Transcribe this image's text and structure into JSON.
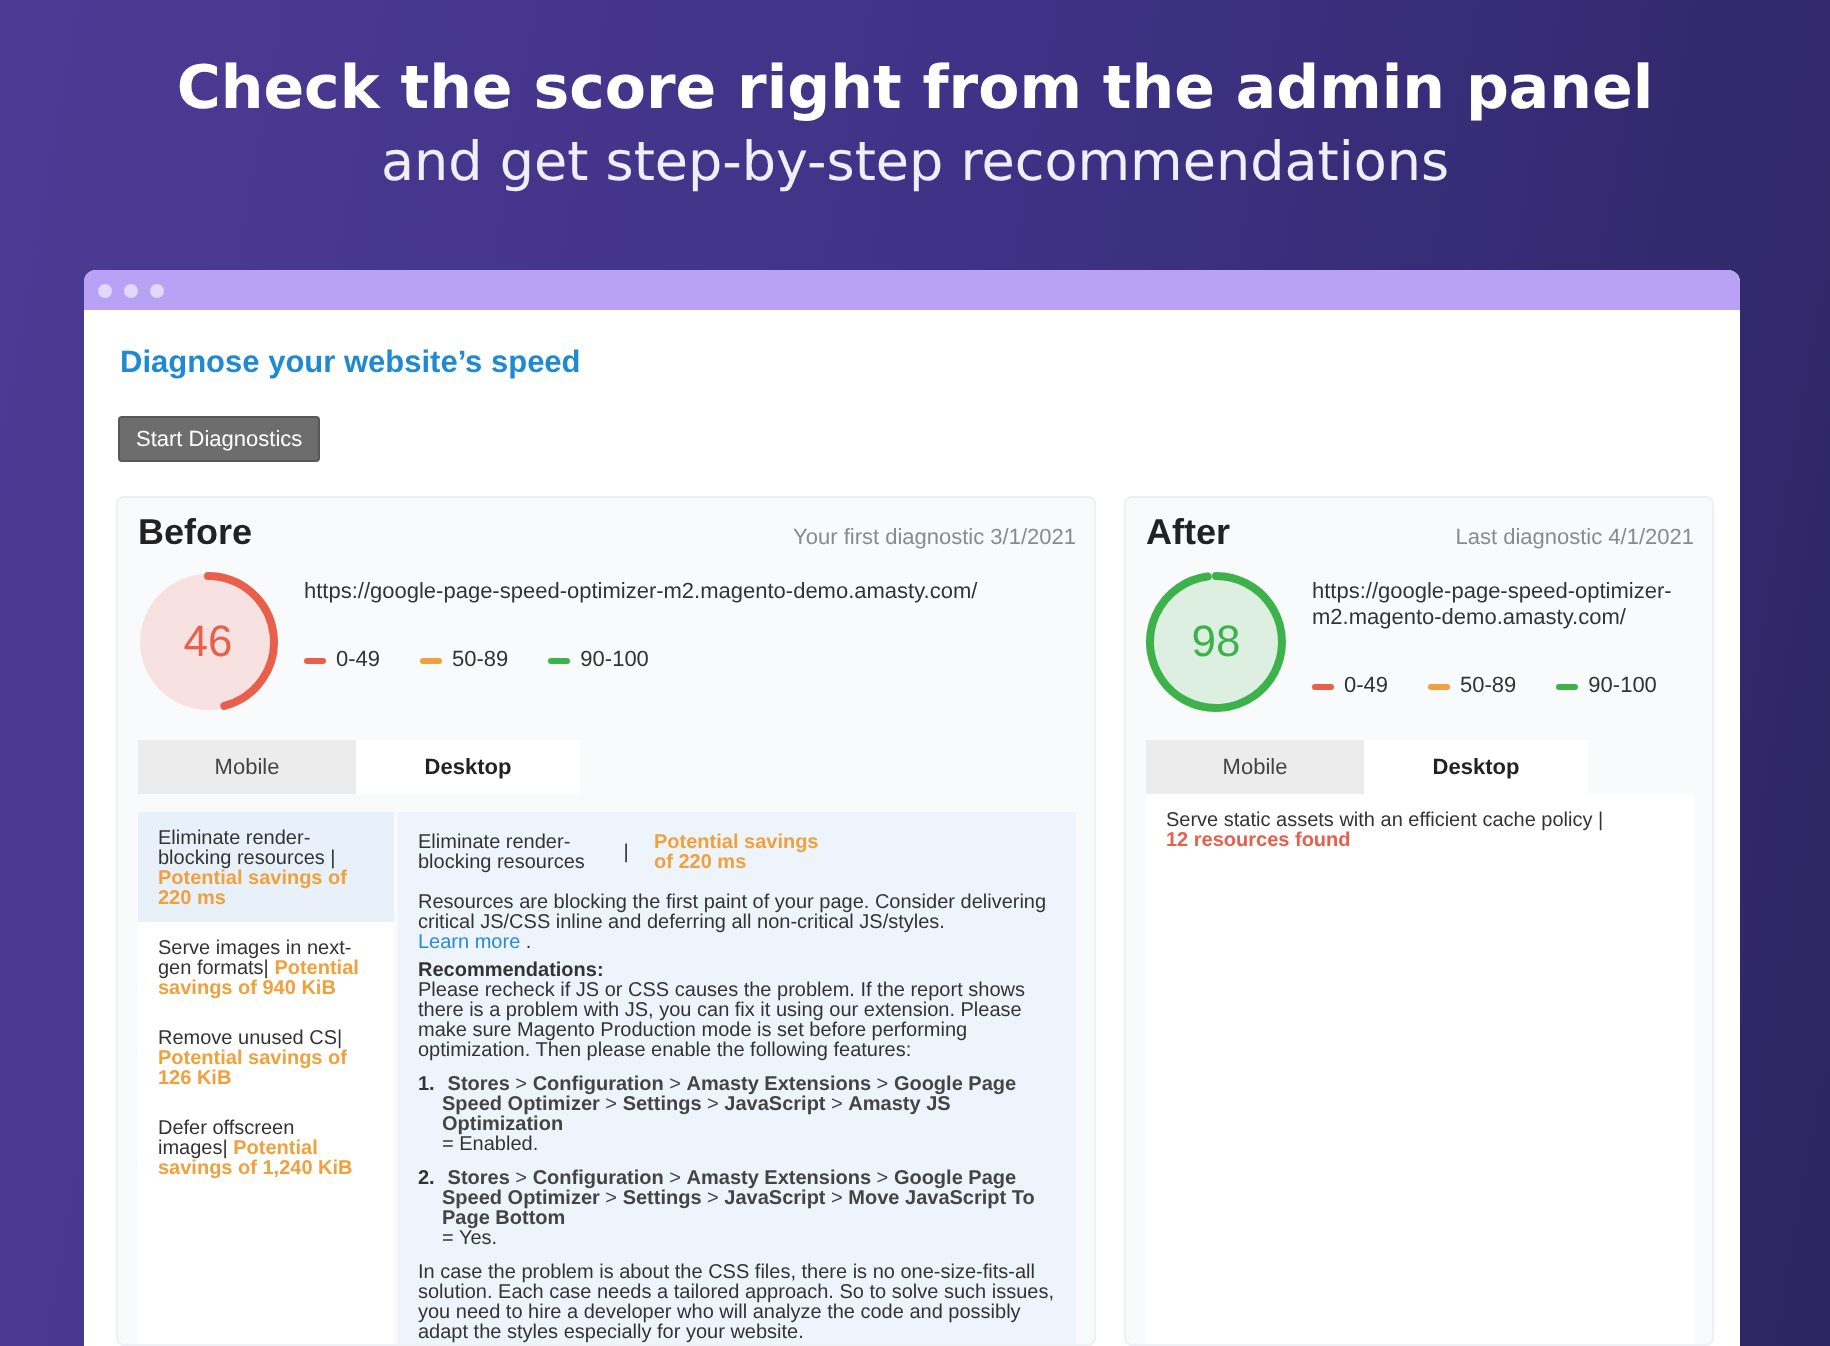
{
  "banner": {
    "title": "Check the score right from the admin panel",
    "subtitle": "and get step-by-step recommendations"
  },
  "window": {
    "heading": "Diagnose your website’s speed",
    "start_button": "Start Diagnostics",
    "reports": [
      {
        "title": "Before",
        "date": "Your first diagnostic 3/1/2021",
        "gauge": {
          "score": "46",
          "level": 0.46,
          "color": "#e8604c"
        },
        "url": "https://google-page-speed-optimizer-m2.magento-demo.amasty.com/",
        "legend": [
          {
            "label": "0-49",
            "color": "#e8604c"
          },
          {
            "label": "50-89",
            "color": "#f0a03c"
          },
          {
            "label": "90-100",
            "color": "#3db24b"
          }
        ],
        "tabs": [
          {
            "label": "Mobile",
            "selected": false
          },
          {
            "label": "Desktop",
            "selected": true
          }
        ],
        "issues": [
          {
            "title": "Eliminate render-blocking resources |",
            "savings": "Potential savings of 220 ms",
            "color": "#f0a03c",
            "selected": true
          },
          {
            "title": "Serve images in next-gen formats|",
            "savings": "Potential savings of 940 KiB",
            "color": "#f0a03c",
            "selected": false
          },
          {
            "title": "Remove unused CS|",
            "savings": "Potential savings of 126 KiB",
            "color": "#f0a03c",
            "selected": false
          },
          {
            "title": "Defer offscreen images|",
            "savings": "Potential savings of 1,240 KiB",
            "color": "#f0a03c",
            "selected": false
          }
        ],
        "detail": {
          "title": "Eliminate render-blocking resources",
          "separator": "|",
          "savings": "Potential savings of 220 ms",
          "description": "Resources are blocking the first paint of your page. Consider delivering critical JS/CSS inline and deferring all non-critical JS/styles.",
          "link": "Learn more",
          "link_after": ".",
          "recommendations_heading": "Recommendations:",
          "intro": "Please recheck if JS or CSS causes the problem. If the report shows there is a problem with JS, you can fix it using our extension. Please make sure Magento Production mode is set before performing optimization. Then please enable the following features:",
          "steps": [
            {
              "number": "1.",
              "path": "**Stores** > **Configuration** > **Amasty Extensions** > **Google Page Speed Optimizer** > **Settings** > **JavaScript** > **Amasty JS Optimization**",
              "value": "= Enabled."
            },
            {
              "number": "2.",
              "path": "**Stores** > **Configuration** > **Amasty Extensions** > **Google Page Speed Optimizer** > **Settings** > **JavaScript** > **Move JavaScript To Page Bottom**",
              "value": "= Yes."
            }
          ],
          "closing": "In case the problem is about the CSS files, there is no one-size-fits-all solution. Each case needs a tailored approach. So to solve such issues, you need to hire a developer who will analyze the code and possibly adapt the styles especially for your website."
        }
      },
      {
        "title": "After",
        "date": "Last diagnostic 4/1/2021",
        "gauge": {
          "score": "98",
          "level": 0.98,
          "color": "#3db24b"
        },
        "url": "https://google-page-speed-optimizer-m2.magento-demo.amasty.com/",
        "legend": [
          {
            "label": "0-49",
            "color": "#e8604c"
          },
          {
            "label": "50-89",
            "color": "#f0a03c"
          },
          {
            "label": "90-100",
            "color": "#3db24b"
          }
        ],
        "tabs": [
          {
            "label": "Mobile",
            "selected": false
          },
          {
            "label": "Desktop",
            "selected": true
          }
        ],
        "issues": [
          {
            "title": "Serve static assets with an efficient cache policy |",
            "savings": "12 resources found",
            "color": "#e8604c",
            "selected": false
          }
        ]
      }
    ]
  }
}
